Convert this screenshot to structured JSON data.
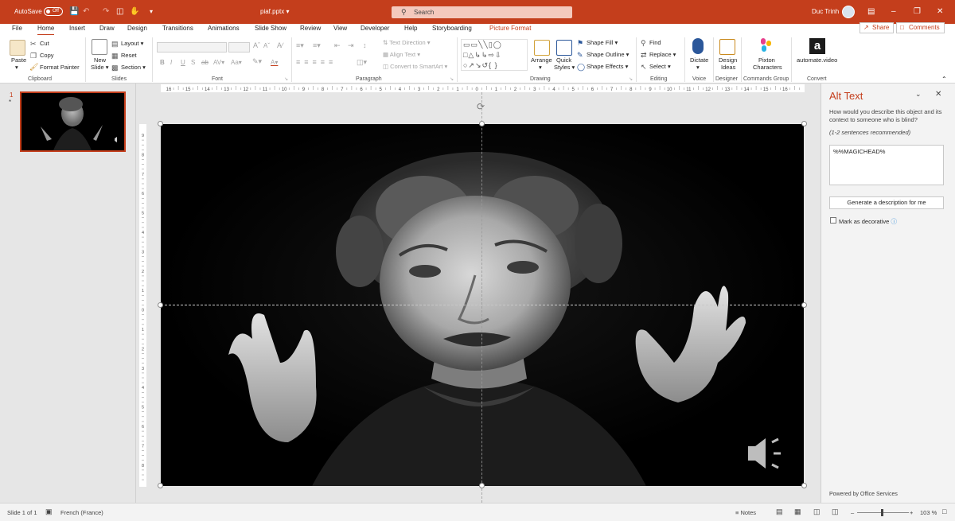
{
  "titlebar": {
    "autosave_label": "AutoSave",
    "autosave_state": "Off",
    "filename": "piaf.pptx",
    "search_placeholder": "Search",
    "user_name": "Duc Trinh"
  },
  "colors": {
    "accent": "#c43e1c",
    "ribbon_bg": "#ffffff",
    "pane_bg": "#f3f3f3"
  },
  "tabs": [
    "File",
    "Home",
    "Insert",
    "Draw",
    "Design",
    "Transitions",
    "Animations",
    "Slide Show",
    "Review",
    "View",
    "Developer",
    "Help",
    "Storyboarding",
    "Picture Format"
  ],
  "active_tab": "Home",
  "header_buttons": {
    "share": "Share",
    "comments": "Comments"
  },
  "ribbon": {
    "clipboard": {
      "paste": "Paste",
      "cut": "Cut",
      "copy": "Copy",
      "format_painter": "Format Painter",
      "group": "Clipboard"
    },
    "slides": {
      "new_slide_1": "New",
      "new_slide_2": "Slide",
      "layout": "Layout",
      "reset": "Reset",
      "section": "Section",
      "group": "Slides"
    },
    "font": {
      "group": "Font"
    },
    "paragraph": {
      "text_direction": "Text Direction",
      "align_text": "Align Text",
      "convert_smartart": "Convert to SmartArt",
      "group": "Paragraph"
    },
    "drawing": {
      "arrange": "Arrange",
      "quick_1": "Quick",
      "quick_2": "Styles",
      "shape_fill": "Shape Fill",
      "shape_outline": "Shape Outline",
      "shape_effects": "Shape Effects",
      "group": "Drawing"
    },
    "editing": {
      "find": "Find",
      "replace": "Replace",
      "select": "Select",
      "group": "Editing"
    },
    "voice": {
      "dictate": "Dictate",
      "group": "Voice"
    },
    "designer": {
      "ideas_1": "Design",
      "ideas_2": "Ideas",
      "group": "Designer"
    },
    "commands": {
      "pixton_1": "Pixton",
      "pixton_2": "Characters",
      "group": "Commands Group"
    },
    "convert": {
      "automate": "automate.video",
      "group": "Convert"
    }
  },
  "thumbnails": [
    {
      "number": "1",
      "marker": "*"
    }
  ],
  "ruler": {
    "h_ticks": [
      "16",
      "15",
      "14",
      "13",
      "12",
      "11",
      "10",
      "9",
      "8",
      "7",
      "6",
      "5",
      "4",
      "3",
      "2",
      "1",
      "0",
      "1",
      "2",
      "3",
      "4",
      "5",
      "6",
      "7",
      "8",
      "9",
      "10",
      "11",
      "12",
      "13",
      "14",
      "15",
      "16"
    ]
  },
  "alt_text": {
    "title": "Alt Text",
    "description": "How would you describe this object and its context to someone who is blind?",
    "recommendation": "(1-2 sentences recommended)",
    "value": "%%MAGICHEAD%",
    "generate_label": "Generate a description for me",
    "decorative_label": "Mark as decorative",
    "powered_by": "Powered by Office Services"
  },
  "status": {
    "slide_info": "Slide 1 of 1",
    "language": "French (France)",
    "notes": "Notes",
    "zoom": "103 %"
  }
}
